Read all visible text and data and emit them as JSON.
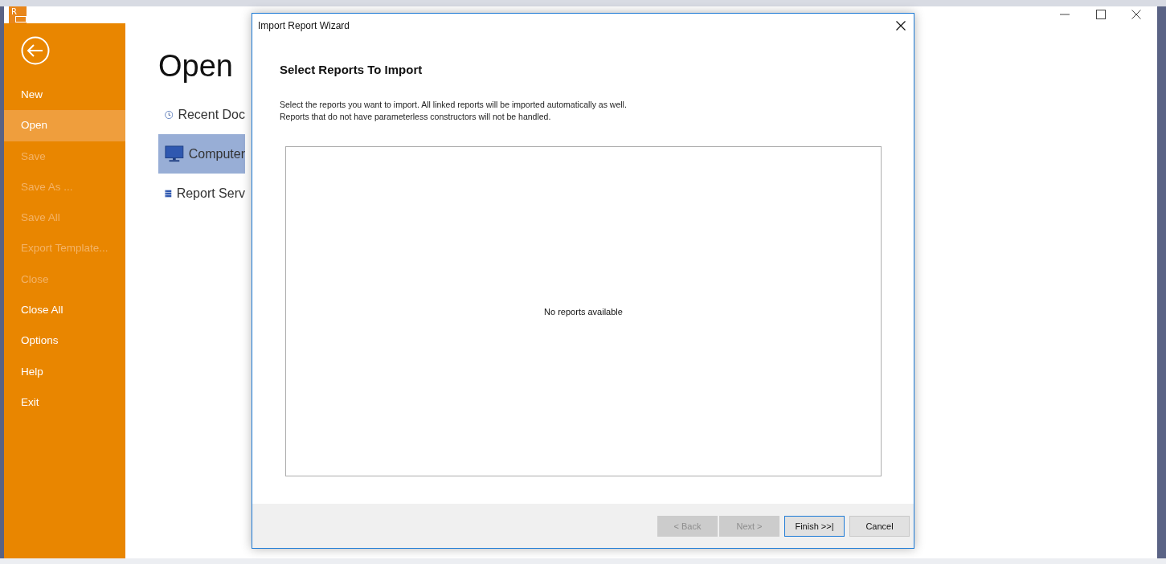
{
  "app": {
    "logo": "R"
  },
  "sidebar": {
    "items": [
      {
        "label": "New",
        "selected": false,
        "disabled": false
      },
      {
        "label": "Open",
        "selected": true,
        "disabled": false
      },
      {
        "label": "Save",
        "selected": false,
        "disabled": true
      },
      {
        "label": "Save As ...",
        "selected": false,
        "disabled": true
      },
      {
        "label": "Save All",
        "selected": false,
        "disabled": true
      },
      {
        "label": "Export Template...",
        "selected": false,
        "disabled": true
      },
      {
        "label": "Close",
        "selected": false,
        "disabled": true
      },
      {
        "label": "Close All",
        "selected": false,
        "disabled": false
      },
      {
        "label": "Options",
        "selected": false,
        "disabled": false
      },
      {
        "label": "Help",
        "selected": false,
        "disabled": false
      },
      {
        "label": "Exit",
        "selected": false,
        "disabled": false
      }
    ]
  },
  "open_page": {
    "title": "Open",
    "locations": [
      {
        "kind": "recent",
        "label": "Recent Doc",
        "selected": false
      },
      {
        "kind": "computer",
        "label": "Computer",
        "selected": true
      },
      {
        "kind": "server",
        "label": "Report Serv",
        "selected": false
      }
    ]
  },
  "dialog": {
    "title": "Import Report Wizard",
    "heading": "Select Reports To Import",
    "description": [
      "Select the reports you want to import. All linked reports will be imported automatically as well.",
      "Reports that do not have parameterless constructors will not be handled."
    ],
    "empty_message": "No reports available",
    "buttons": [
      {
        "label": "< Back",
        "disabled": true,
        "default": false
      },
      {
        "label": "Next >",
        "disabled": true,
        "default": false
      },
      {
        "label": "Finish >>|",
        "disabled": false,
        "default": true
      },
      {
        "label": "Cancel",
        "disabled": false,
        "default": false
      }
    ]
  }
}
